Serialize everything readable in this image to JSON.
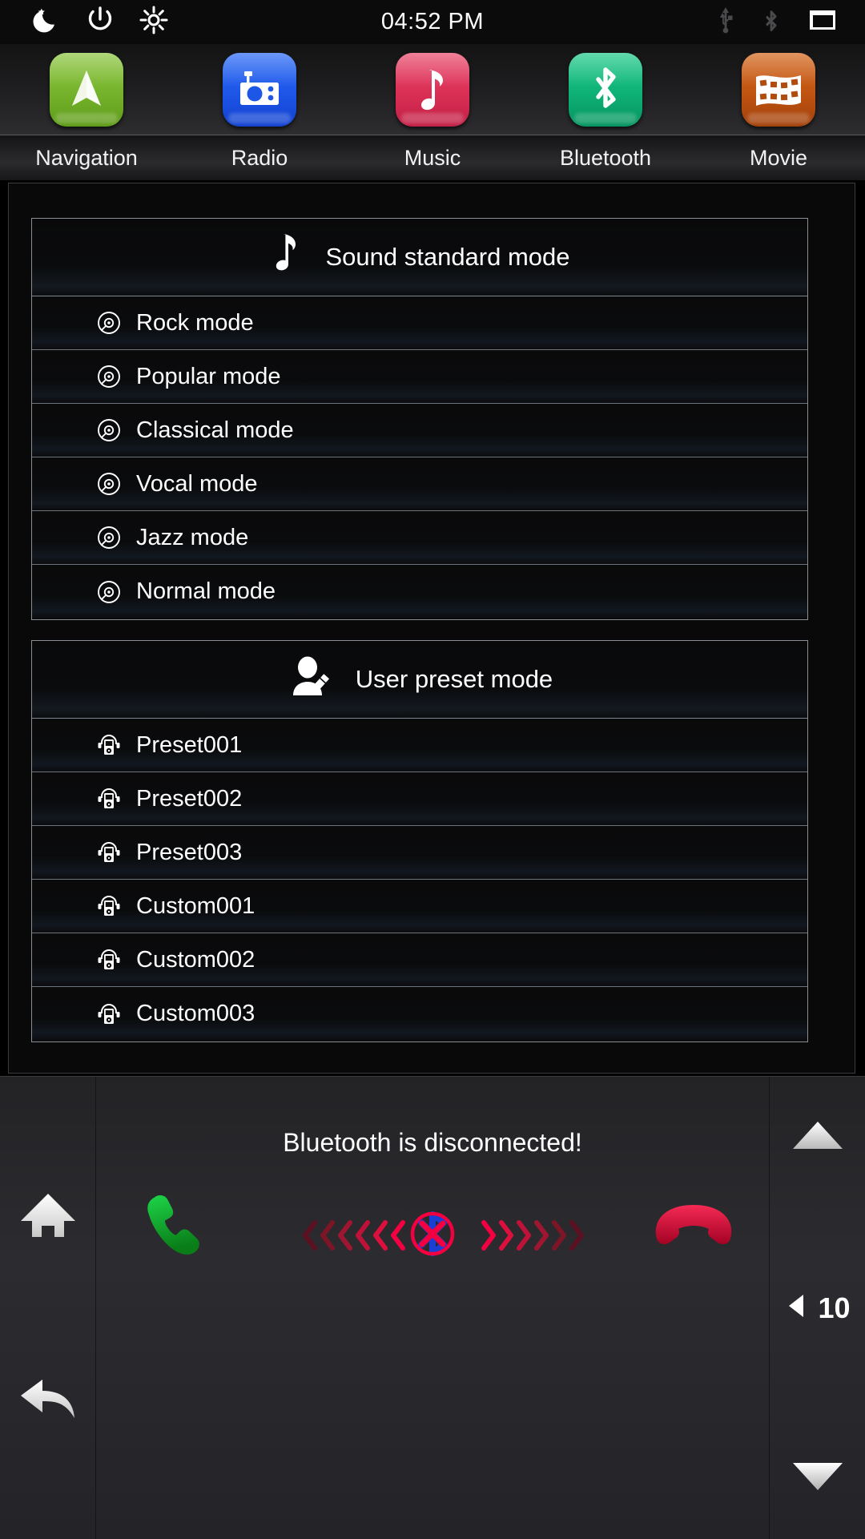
{
  "statusbar": {
    "time": "04:52 PM",
    "left_icons": [
      {
        "name": "night-mode-icon",
        "label": "Night mode"
      },
      {
        "name": "power-icon",
        "label": "Power"
      },
      {
        "name": "brightness-icon",
        "label": "Brightness"
      }
    ],
    "right_icons": [
      {
        "name": "usb-icon",
        "label": "USB",
        "state": "inactive"
      },
      {
        "name": "bluetooth-status-icon",
        "label": "Bluetooth",
        "state": "inactive"
      },
      {
        "name": "multitask-icon",
        "label": "Windows",
        "state": "active"
      }
    ]
  },
  "dock": {
    "apps": [
      {
        "label": "Navigation",
        "icon": "navigation-arrow-icon",
        "color": "#76b32c"
      },
      {
        "label": "Radio",
        "icon": "radio-icon",
        "color": "#1e56e8"
      },
      {
        "label": "Music",
        "icon": "music-note-icon",
        "color": "#da2f55"
      },
      {
        "label": "Bluetooth",
        "icon": "bluetooth-icon",
        "color": "#0eb177"
      },
      {
        "label": "Movie",
        "icon": "film-strip-icon",
        "color": "#c05412"
      }
    ]
  },
  "sound_panel": {
    "title": "Sound standard mode",
    "header_icon": "music-note-icon",
    "items": [
      {
        "label": "Rock mode",
        "icon": "disc-icon"
      },
      {
        "label": "Popular mode",
        "icon": "disc-icon"
      },
      {
        "label": "Classical mode",
        "icon": "disc-icon"
      },
      {
        "label": "Vocal mode",
        "icon": "disc-icon"
      },
      {
        "label": "Jazz mode",
        "icon": "disc-icon"
      },
      {
        "label": "Normal mode",
        "icon": "disc-icon"
      }
    ]
  },
  "preset_panel": {
    "title": "User preset mode",
    "header_icon": "user-edit-icon",
    "items": [
      {
        "label": "Preset001",
        "icon": "media-player-headphones-icon"
      },
      {
        "label": "Preset002",
        "icon": "media-player-headphones-icon"
      },
      {
        "label": "Preset003",
        "icon": "media-player-headphones-icon"
      },
      {
        "label": "Custom001",
        "icon": "media-player-headphones-icon"
      },
      {
        "label": "Custom002",
        "icon": "media-player-headphones-icon"
      },
      {
        "label": "Custom003",
        "icon": "media-player-headphones-icon"
      }
    ]
  },
  "bottombar": {
    "home_icon": "home-icon",
    "back_icon": "back-arrow-icon",
    "status_message": "Bluetooth is disconnected!",
    "answer_call_icon": "phone-answer-icon",
    "end_call_icon": "phone-hangup-icon",
    "disconnect_icon": "bluetooth-disconnected-icon",
    "volume_value": "10",
    "volume_up_icon": "volume-up-icon",
    "volume_down_icon": "volume-down-icon",
    "speaker_icon": "speaker-icon",
    "accent_green": "#16a330",
    "accent_red": "#e0173f",
    "accent_blue": "#1b3fd4"
  }
}
